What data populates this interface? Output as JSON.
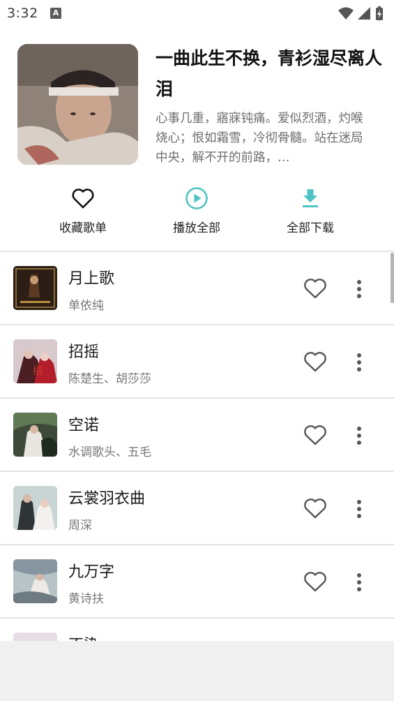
{
  "status_bar": {
    "time": "3:32",
    "notification_icon": "A"
  },
  "playlist": {
    "title": "一曲此生不换，青衫湿尽离人泪",
    "description": "心事几重，寤寐钝痛。爱似烈酒，灼喉烧心；恨如霜雪，冷彻骨髓。站在迷局中央，解不开的前路，…"
  },
  "actions": [
    {
      "label": "收藏歌单",
      "icon": "heart-outline-icon"
    },
    {
      "label": "播放全部",
      "icon": "play-circle-icon"
    },
    {
      "label": "全部下载",
      "icon": "download-icon"
    }
  ],
  "songs": [
    {
      "title": "月上歌",
      "artist": "单依纯"
    },
    {
      "title": "招摇",
      "artist": "陈楚生、胡莎莎"
    },
    {
      "title": "空诺",
      "artist": "水调歌头、五毛"
    },
    {
      "title": "云裳羽衣曲",
      "artist": "周深"
    },
    {
      "title": "九万字",
      "artist": "黄诗扶"
    },
    {
      "title": "不染",
      "artist": ""
    }
  ],
  "colors": {
    "accent": "#4fc3c3",
    "text": "#1a1a1a",
    "secondary": "#777777"
  }
}
